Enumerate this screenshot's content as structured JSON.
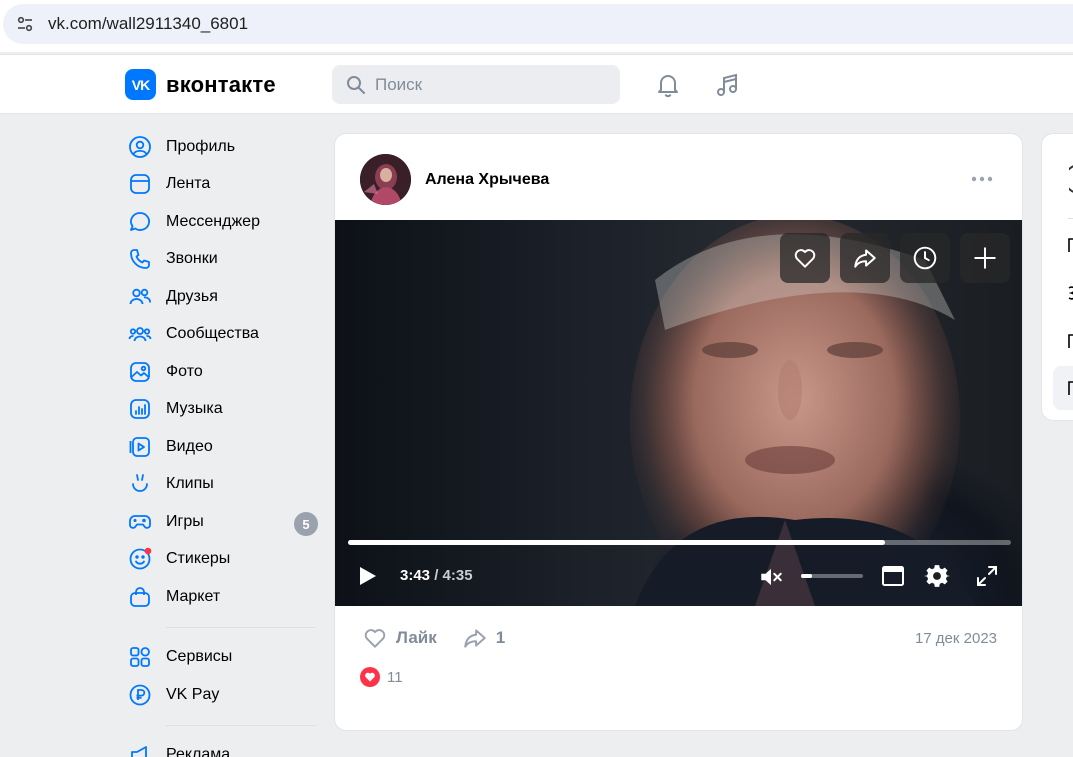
{
  "browser": {
    "url": "vk.com/wall2911340_6801"
  },
  "header": {
    "logo_mark": "VK",
    "logo_text": "вконтакте",
    "search_placeholder": "Поиск"
  },
  "nav": {
    "items": [
      {
        "label": "Профиль",
        "icon": "profile-icon"
      },
      {
        "label": "Лента",
        "icon": "feed-icon"
      },
      {
        "label": "Мессенджер",
        "icon": "messenger-icon"
      },
      {
        "label": "Звонки",
        "icon": "phone-icon"
      },
      {
        "label": "Друзья",
        "icon": "friends-icon"
      },
      {
        "label": "Сообщества",
        "icon": "communities-icon"
      },
      {
        "label": "Фото",
        "icon": "photo-icon"
      },
      {
        "label": "Музыка",
        "icon": "music-icon"
      },
      {
        "label": "Видео",
        "icon": "video-icon"
      },
      {
        "label": "Клипы",
        "icon": "clips-icon"
      },
      {
        "label": "Игры",
        "icon": "games-icon",
        "badge": "5"
      },
      {
        "label": "Стикеры",
        "icon": "stickers-icon"
      },
      {
        "label": "Маркет",
        "icon": "market-icon"
      }
    ],
    "secondary": [
      {
        "label": "Сервисы",
        "icon": "services-icon"
      },
      {
        "label": "VK Pay",
        "icon": "vkpay-icon"
      }
    ],
    "cut_item": {
      "label": "Реклама"
    }
  },
  "post": {
    "author": "Алена Хрычева",
    "video": {
      "current_time": "3:43",
      "duration": "4:35",
      "time_sep": " / ",
      "progress": 0.81,
      "volume": 0.18
    },
    "like_label": "Лайк",
    "share_count": "1",
    "date": "17 дек 2023",
    "likes_count": "11"
  },
  "colors": {
    "accent": "#0077ff",
    "like_red": "#ff3347",
    "muted": "#818c99"
  }
}
